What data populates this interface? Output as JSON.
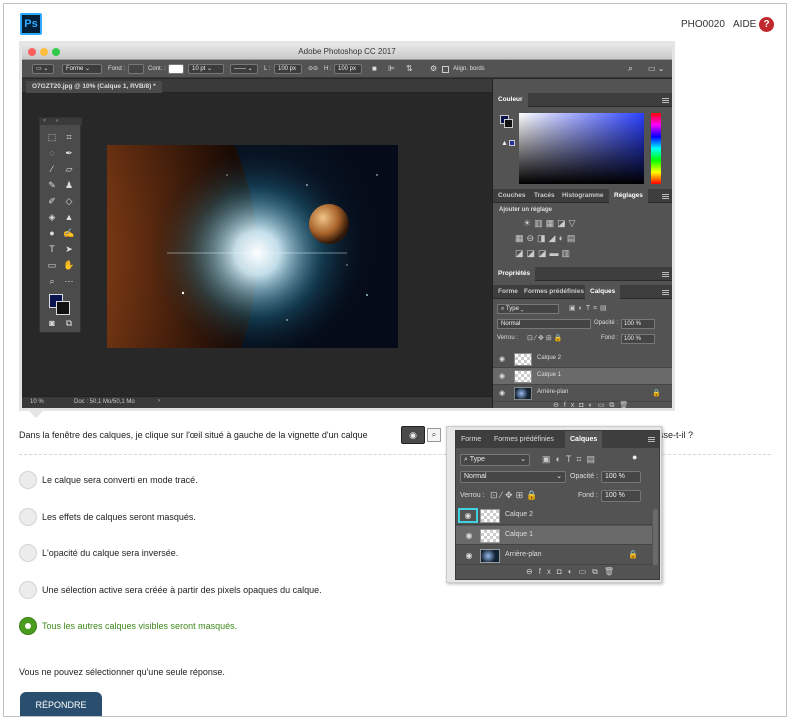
{
  "header": {
    "logo_text": "Ps",
    "course_code": "PHO0020",
    "help_label": "AIDE",
    "help_icon": "?"
  },
  "photoshop": {
    "window_title": "Adobe Photoshop CC 2017",
    "options_bar": {
      "shape_mode": "Forme",
      "fill_label": "Fond :",
      "stroke_label": "Cont. :",
      "stroke_size": "10 pt",
      "width_label": "L :",
      "width_value": "100 px",
      "height_label": "H :",
      "height_value": "100 px",
      "align_edges": "Align. bords"
    },
    "doc_tab": "O7GZT20.jpg @ 10% (Calque 1, RVB/8) *",
    "status_zoom": "10 %",
    "status_doc": "Doc : 50,1 Mo/50,1 Mo",
    "color_panel_title": "Couleur",
    "tabs_mid": [
      "Couches",
      "Tracés",
      "Histogramme",
      "Réglages"
    ],
    "adjust_label": "Ajouter un réglage",
    "properties_title": "Propriétés",
    "layers_tabs": [
      "Forme",
      "Formes prédéfinies",
      "Calques"
    ],
    "filter_type": "Type",
    "blend_mode": "Normal",
    "opacity_label": "Opacité :",
    "opacity_value": "100 %",
    "lock_label": "Verrou :",
    "fill_label": "Fond :",
    "fill_value": "100 %",
    "layers": [
      "Calque 2",
      "Calque 1",
      "Arrière-plan"
    ]
  },
  "question": {
    "text_before": "Dans la fenêtre des calques, je clique sur l'œil situé à gauche de la vignette d'un calque",
    "text_after": "asse-t-il ?"
  },
  "options": [
    {
      "label": "Le calque sera converti en mode tracé.",
      "selected": false
    },
    {
      "label": "Les effets de calques seront masqués.",
      "selected": false
    },
    {
      "label": "L'opacité du calque sera inversée.",
      "selected": false
    },
    {
      "label": "Une sélection active sera créée à partir des pixels opaques du calque.",
      "selected": false
    },
    {
      "label": "Tous les autres calques visibles seront masqués.",
      "selected": true
    }
  ],
  "note": "Vous ne pouvez sélectionner qu'une seule réponse.",
  "submit_label": "RÉPONDRE",
  "zoom_popup": {
    "tabs": [
      "Forme",
      "Formes prédéfinies",
      "Calques"
    ],
    "filter_type": "Type",
    "blend_mode": "Normal",
    "opacity_label": "Opacité :",
    "opacity_value": "100 %",
    "lock_label": "Verrou :",
    "fill_label": "Fond :",
    "fill_value": "100 %",
    "layers": [
      "Calque 2",
      "Calque 1",
      "Arrière-plan"
    ]
  },
  "colors": {
    "accent_green": "#4a9c1e",
    "button_blue": "#2a4f6e",
    "help_red": "#c0282e",
    "highlight_cyan": "#3fd2e0"
  }
}
